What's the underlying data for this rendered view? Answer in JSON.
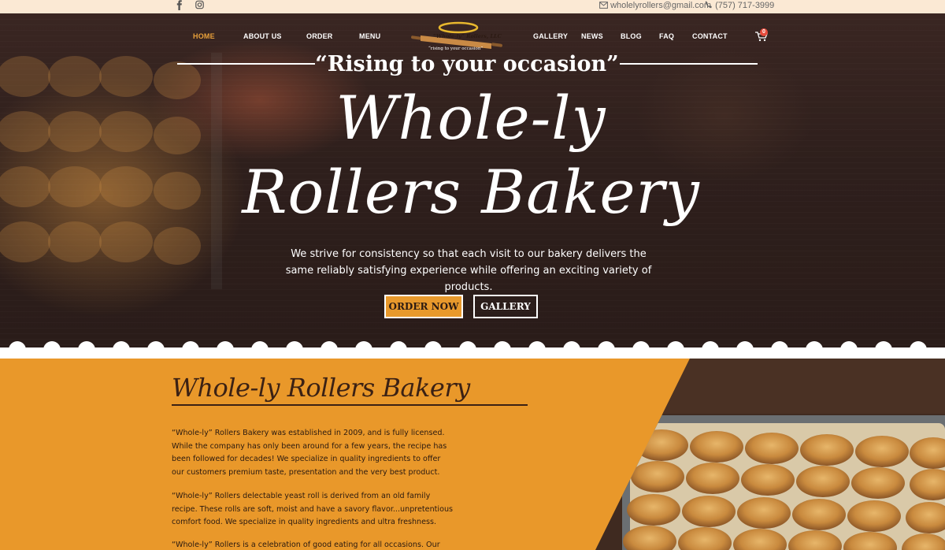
{
  "topbar": {
    "email": "wholelyrollers@gmail.com",
    "phone": "(757) 717-3999"
  },
  "nav": {
    "left": [
      "HOME",
      "ABOUT US",
      "ORDER",
      "MENU"
    ],
    "right": [
      "GALLERY",
      "NEWS",
      "BLOG",
      "FAQ",
      "CONTACT"
    ],
    "cart_count": "0"
  },
  "logo": {
    "name": "“Whole-ly” Rollers, LLC",
    "slogan": "“rising to your occasion”"
  },
  "hero": {
    "tagline": "“Rising to your occasion”",
    "title_line1": "Whole-ly",
    "title_line2": "Rollers Bakery",
    "lead": "We strive for consistency so that each visit to our bakery delivers the same reliably satisfying experience while offering an exciting variety of products.",
    "order_btn": "ORDER NOW",
    "gallery_btn": "GALLERY"
  },
  "about": {
    "title": "Whole-ly Rollers Bakery",
    "p1": "“Whole-ly” Rollers Bakery was established in 2009, and is fully licensed. While the company has only been around for a few years, the recipe has been followed for decades! We specialize in quality ingredients to offer our customers premium taste, presentation and the very best product.",
    "p2": "“Whole-ly” Rollers delectable yeast roll is derived from an old family recipe. These rolls are soft, moist and have a savory flavor...unpretentious comfort food. We specialize in quality ingredients and ultra freshness.",
    "p3": "“Whole-ly” Rollers is a celebration of good eating for all occasions. Our mission is"
  },
  "colors": {
    "accent": "#e9982a",
    "brown": "#3b2114",
    "topbar": "#fbe9d4",
    "active_nav": "#e8a03a"
  }
}
